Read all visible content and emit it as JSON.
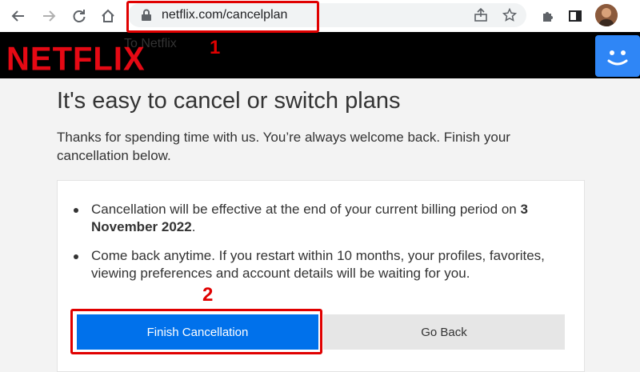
{
  "browser": {
    "url": "netflix.com/cancelplan",
    "icons": [
      "back-icon",
      "forward-icon",
      "reload-icon",
      "home-icon",
      "lock-icon",
      "share-icon",
      "star-icon",
      "extensions-icon",
      "sidebar-icon",
      "avatar"
    ]
  },
  "header": {
    "brand": "NETFLIX",
    "obscured_text": "To Netflix"
  },
  "main": {
    "title": "It's easy to cancel or switch plans",
    "subtitle": "Thanks for spending time with us. You’re always welcome back. Finish your cancellation below.",
    "bullets": [
      {
        "text": "Cancellation will be effective at the end of your current billing period on ",
        "bold": "3 November 2022",
        "after": "."
      },
      {
        "text": "Come back anytime. If you restart within 10 months, your profiles, favorites, viewing preferences and account details will be waiting for you."
      }
    ],
    "finish_label": "Finish Cancellation",
    "back_label": "Go Back"
  },
  "annotations": {
    "step1": "1",
    "step2": "2"
  },
  "colors": {
    "brand_red": "#e50914",
    "primary_blue": "#0071eb",
    "annotation_red": "#e00000"
  }
}
